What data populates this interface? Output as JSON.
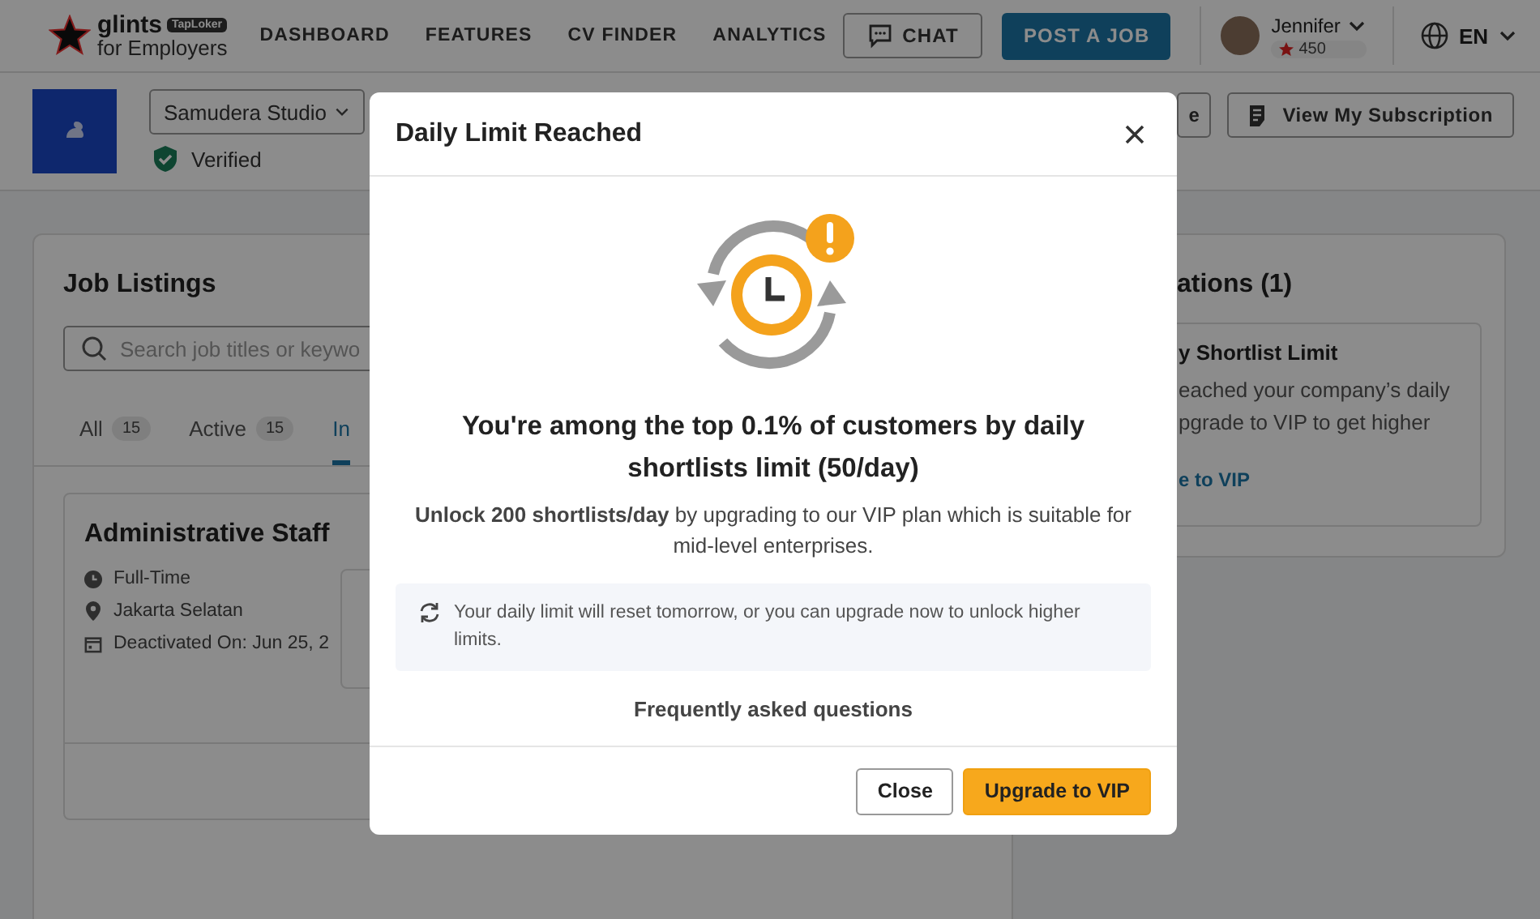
{
  "header": {
    "brand": "glints",
    "brand_badge": "TapLoker",
    "brand_sub": "for Employers",
    "nav": [
      {
        "label": "DASHBOARD"
      },
      {
        "label": "FEATURES"
      },
      {
        "label": "CV FINDER"
      },
      {
        "label": "ANALYTICS"
      }
    ],
    "chat_button": "CHAT",
    "post_button": "POST A JOB",
    "user": {
      "name": "Jennifer",
      "points": "450"
    },
    "language": "EN"
  },
  "company_bar": {
    "company": "Samudera Studio",
    "verified": "Verified",
    "partial_button": "e",
    "subscription_button": "View My Subscription"
  },
  "job_listings": {
    "title": "Job Listings",
    "search": {
      "placeholder": "Search job titles or keywo"
    },
    "tabs": [
      {
        "label": "All",
        "count": "15",
        "selected": false
      },
      {
        "label": "Active",
        "count": "15",
        "selected": false
      },
      {
        "label": "In",
        "selected": true
      }
    ],
    "job": {
      "title": "Administrative Staff",
      "type": "Full-Time",
      "location": "Jakarta Selatan",
      "deactivated": "Deactivated On: Jun 25, 2"
    }
  },
  "notifications": {
    "title": "ations (1)",
    "item_title": "y Shortlist Limit",
    "item_lines": [
      "eached your company’s daily",
      "pgrade to VIP to get higher"
    ],
    "link": "e to VIP"
  },
  "dialog": {
    "title": "Daily Limit Reached",
    "heading": "You're among the top 0.1% of customers by daily shortlists limit (50/day)",
    "text": "**Unlock 200 shortlists/day** by upgrading to our VIP plan which is suitable for mid-level enterprises.",
    "notice": "Your daily limit will reset tomorrow, or you can upgrade now to unlock higher limits.",
    "faq_link": "Frequently asked questions",
    "buttons": [
      {
        "label": "Close",
        "kind": "secondary"
      },
      {
        "label": "Upgrade to VIP",
        "kind": "primary"
      }
    ]
  }
}
